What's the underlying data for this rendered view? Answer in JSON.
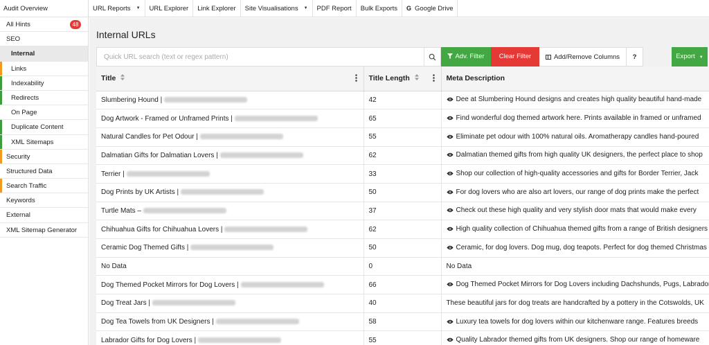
{
  "sidebar": {
    "audit_overview": "Audit Overview",
    "items": [
      {
        "label": "All Hints",
        "badge": "48",
        "level": "top",
        "bar": "",
        "active": false
      },
      {
        "label": "SEO",
        "badge": "",
        "level": "top",
        "bar": "",
        "active": false
      },
      {
        "label": "Internal",
        "badge": "",
        "level": "sub",
        "bar": "",
        "active": true
      },
      {
        "label": "Links",
        "badge": "",
        "level": "sub",
        "bar": "orange",
        "active": false
      },
      {
        "label": "Indexability",
        "badge": "",
        "level": "sub",
        "bar": "green",
        "active": false
      },
      {
        "label": "Redirects",
        "badge": "",
        "level": "sub",
        "bar": "green",
        "active": false
      },
      {
        "label": "On Page",
        "badge": "",
        "level": "sub",
        "bar": "",
        "active": false
      },
      {
        "label": "Duplicate Content",
        "badge": "",
        "level": "sub",
        "bar": "green",
        "active": false
      },
      {
        "label": "XML Sitemaps",
        "badge": "",
        "level": "sub",
        "bar": "green",
        "active": false
      },
      {
        "label": "Security",
        "badge": "",
        "level": "top",
        "bar": "orange",
        "active": false
      },
      {
        "label": "Structured Data",
        "badge": "",
        "level": "top",
        "bar": "",
        "active": false
      },
      {
        "label": "Search Traffic",
        "badge": "",
        "level": "top",
        "bar": "orange",
        "active": false
      },
      {
        "label": "Keywords",
        "badge": "",
        "level": "top",
        "bar": "",
        "active": false
      },
      {
        "label": "External",
        "badge": "",
        "level": "top",
        "bar": "",
        "active": false
      },
      {
        "label": "XML Sitemap Generator",
        "badge": "",
        "level": "top",
        "bar": "",
        "active": false
      }
    ]
  },
  "topnav": {
    "items": [
      {
        "label": "URL Reports",
        "caret": true,
        "icon": ""
      },
      {
        "label": "URL Explorer",
        "caret": false,
        "icon": ""
      },
      {
        "label": "Link Explorer",
        "caret": false,
        "icon": ""
      },
      {
        "label": "Site Visualisations",
        "caret": true,
        "icon": ""
      },
      {
        "label": "PDF Report",
        "caret": false,
        "icon": ""
      },
      {
        "label": "Bulk Exports",
        "caret": false,
        "icon": ""
      },
      {
        "label": "Google Drive",
        "caret": false,
        "icon": "G"
      }
    ]
  },
  "main": {
    "title": "Internal URLs",
    "search": {
      "placeholder": "Quick URL search (text or regex pattern)",
      "value": ""
    },
    "buttons": {
      "adv_filter": "Adv. Filter",
      "clear_filter": "Clear Filter",
      "add_remove_columns": "Add/Remove Columns",
      "help": "?",
      "export": "Export"
    }
  },
  "table": {
    "columns": [
      "Title",
      "Title Length",
      "Meta Description"
    ],
    "rows": [
      {
        "title": "Slumbering Hound |",
        "blurred": true,
        "length": "42",
        "eye": true,
        "meta": "Dee at Slumbering Hound designs and creates high quality beautiful hand-made"
      },
      {
        "title": "Dog Artwork - Framed or Unframed Prints |",
        "blurred": true,
        "length": "65",
        "eye": true,
        "meta": "Find wonderful dog themed artwork here. Prints available in framed or unframed"
      },
      {
        "title": "Natural Candles for Pet Odour |",
        "blurred": true,
        "length": "55",
        "eye": true,
        "meta": "Eliminate pet odour with 100% natural oils. Aromatherapy candles hand-poured"
      },
      {
        "title": "Dalmatian Gifts for Dalmatian Lovers |",
        "blurred": true,
        "length": "62",
        "eye": true,
        "meta": "Dalmatian themed gifts from high quality UK designers, the perfect place to shop"
      },
      {
        "title": "Terrier |",
        "blurred": true,
        "length": "33",
        "eye": true,
        "meta": "Shop our collection of high-quality accessories and gifts for Border Terrier, Jack"
      },
      {
        "title": "Dog Prints by UK Artists |",
        "blurred": true,
        "length": "50",
        "eye": true,
        "meta": "For dog lovers who are also art lovers, our range of dog prints make the perfect"
      },
      {
        "title": "Turtle Mats –",
        "blurred": true,
        "length": "37",
        "eye": true,
        "meta": "Check out these high quality and very stylish door mats that would make every"
      },
      {
        "title": "Chihuahua Gifts for Chihuahua Lovers |",
        "blurred": true,
        "length": "62",
        "eye": true,
        "meta": "High quality collection of Chihuahua themed gifts from a range of British designers"
      },
      {
        "title": "Ceramic Dog Themed Gifts |",
        "blurred": true,
        "length": "50",
        "eye": true,
        "meta": "Ceramic, for dog lovers. Dog mug, dog teapots. Perfect for dog themed Christmas"
      },
      {
        "title": "No Data",
        "blurred": false,
        "length": "0",
        "eye": false,
        "meta": "No Data"
      },
      {
        "title": "Dog Themed Pocket Mirrors for Dog Lovers |",
        "blurred": true,
        "length": "66",
        "eye": true,
        "meta": "Dog Themed Pocket Mirrors for Dog Lovers including Dachshunds, Pugs, Labradors"
      },
      {
        "title": "Dog Treat Jars |",
        "blurred": true,
        "length": "40",
        "eye": false,
        "meta": "These beautiful jars for dog treats are handcrafted by a pottery in the Cotswolds, UK"
      },
      {
        "title": "Dog Tea Towels from UK Designers |",
        "blurred": true,
        "length": "58",
        "eye": true,
        "meta": "Luxury tea towels for dog lovers within our kitchenware range. Features breeds"
      },
      {
        "title": "Labrador Gifts for Dog Lovers |",
        "blurred": true,
        "length": "55",
        "eye": true,
        "meta": "Quality Labrador themed gifts from UK designers. Shop our range of homeware"
      }
    ]
  },
  "colors": {
    "green": "#43a843",
    "red": "#e53935",
    "orange": "#f29a1f",
    "badge": "#e53935"
  },
  "icons": [
    "search-icon",
    "filter-icon",
    "columns-icon",
    "sort-icon",
    "kebab-menu-icon",
    "eye-icon",
    "caret-down-icon",
    "google-drive-icon"
  ]
}
